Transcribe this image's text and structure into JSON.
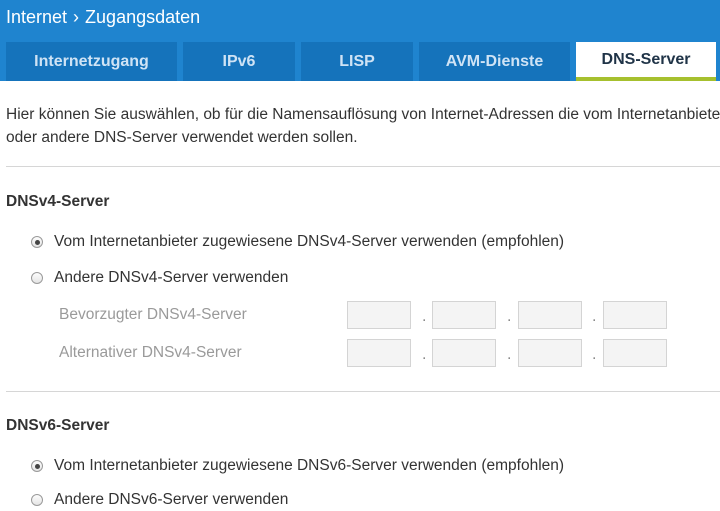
{
  "header": {
    "breadcrumb": [
      "Internet",
      "Zugangsdaten"
    ],
    "separator": "›"
  },
  "tabs": [
    {
      "label": "Internetzugang",
      "active": false
    },
    {
      "label": "IPv6",
      "active": false
    },
    {
      "label": "LISP",
      "active": false
    },
    {
      "label": "AVM-Dienste",
      "active": false
    },
    {
      "label": "DNS-Server",
      "active": true
    }
  ],
  "intro": {
    "line1": "Hier können Sie auswählen, ob für die Namensauflösung von Internet-Adressen die vom Internetanbieter",
    "line2": "oder andere DNS-Server verwendet werden sollen."
  },
  "dnsv4": {
    "title": "DNSv4-Server",
    "option_provider": "Vom Internetanbieter zugewiesene DNSv4-Server verwenden (empfohlen)",
    "option_other": "Andere DNSv4-Server verwenden",
    "selected": "provider",
    "preferred_label": "Bevorzugter DNSv4-Server",
    "alternative_label": "Alternativer DNSv4-Server",
    "preferred_octets": [
      "",
      "",
      "",
      ""
    ],
    "alternative_octets": [
      "",
      "",
      "",
      ""
    ],
    "octet_separator": "."
  },
  "dnsv6": {
    "title": "DNSv6-Server",
    "option_provider": "Vom Internetanbieter zugewiesene DNSv6-Server verwenden (empfohlen)",
    "option_other": "Andere DNSv6-Server verwenden",
    "selected": "provider"
  },
  "colors": {
    "header_bg": "#1f84cf",
    "tab_bg": "#1573bb",
    "tab_active_underline": "#a6c02e"
  }
}
